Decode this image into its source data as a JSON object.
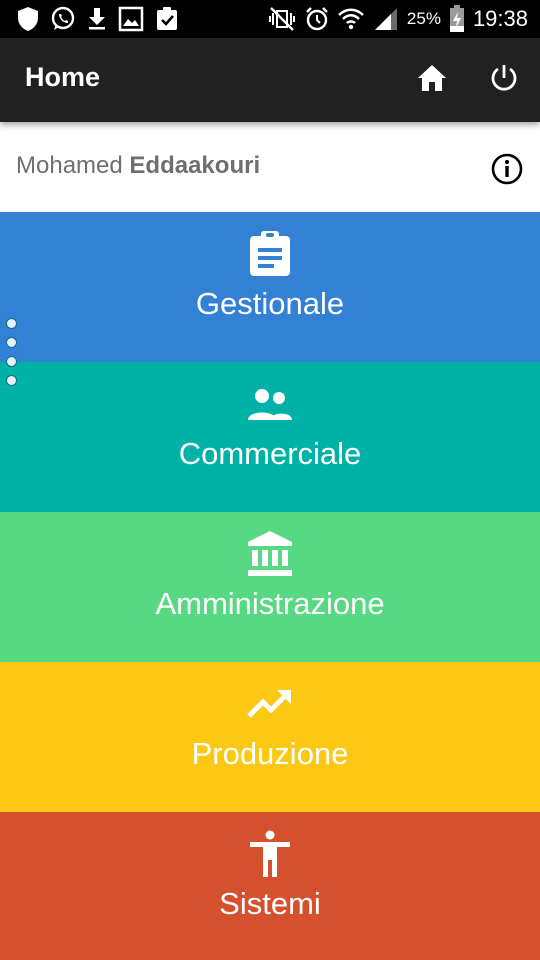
{
  "status_bar": {
    "battery_percent": "25%",
    "time": "19:38",
    "left_icons": [
      "shield-icon",
      "whatsapp-icon",
      "download-icon",
      "image-icon",
      "clipboard-check-icon"
    ],
    "right_icons": [
      "vibrate-mute-icon",
      "alarm-icon",
      "wifi-icon",
      "signal-icon",
      "battery-charging-icon"
    ]
  },
  "app_bar": {
    "title": "Home",
    "actions": [
      "home-icon",
      "power-icon"
    ]
  },
  "user": {
    "first_name": "Mohamed",
    "last_name": "Eddaakouri",
    "info_icon": "info-icon"
  },
  "tiles": [
    {
      "label": "Gestionale",
      "icon": "clipboard-icon",
      "color": "#3281D4"
    },
    {
      "label": "Commerciale",
      "icon": "people-icon",
      "color": "#00B1A8"
    },
    {
      "label": "Amministrazione",
      "icon": "bank-icon",
      "color": "#57D882"
    },
    {
      "label": "Produzione",
      "icon": "trending-up-icon",
      "color": "#FDC814"
    },
    {
      "label": "Sistemi",
      "icon": "accessibility-icon",
      "color": "#D5502D"
    }
  ],
  "pager": {
    "dots": 4,
    "dot_color": "#E6F2FA"
  }
}
